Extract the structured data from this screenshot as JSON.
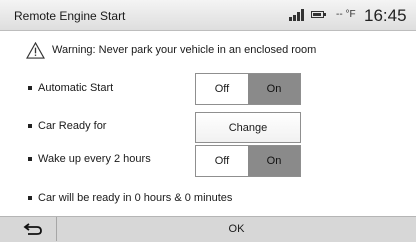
{
  "header": {
    "title": "Remote Engine Start",
    "temperature": "-- °F",
    "time": "16:45",
    "icons": [
      "signal-icon",
      "battery-icon"
    ]
  },
  "warning": {
    "icon": "warning-triangle-icon",
    "text": "Warning: Never park your vehicle in an enclosed room"
  },
  "settings": {
    "automatic_start": {
      "label": "Automatic Start",
      "off": "Off",
      "on": "On",
      "selected": "On"
    },
    "car_ready_for": {
      "label": "Car Ready for",
      "button": "Change"
    },
    "wake_up": {
      "label": "Wake up every 2 hours",
      "off": "Off",
      "on": "On",
      "selected": "On"
    }
  },
  "status_text": "Car will be ready in 0 hours & 0 minutes",
  "footer": {
    "back_icon": "back-arrow-icon",
    "ok_label": "OK"
  },
  "colors": {
    "selected_toggle": "#8a8a8a",
    "footer_bg": "#d7d7d7"
  }
}
